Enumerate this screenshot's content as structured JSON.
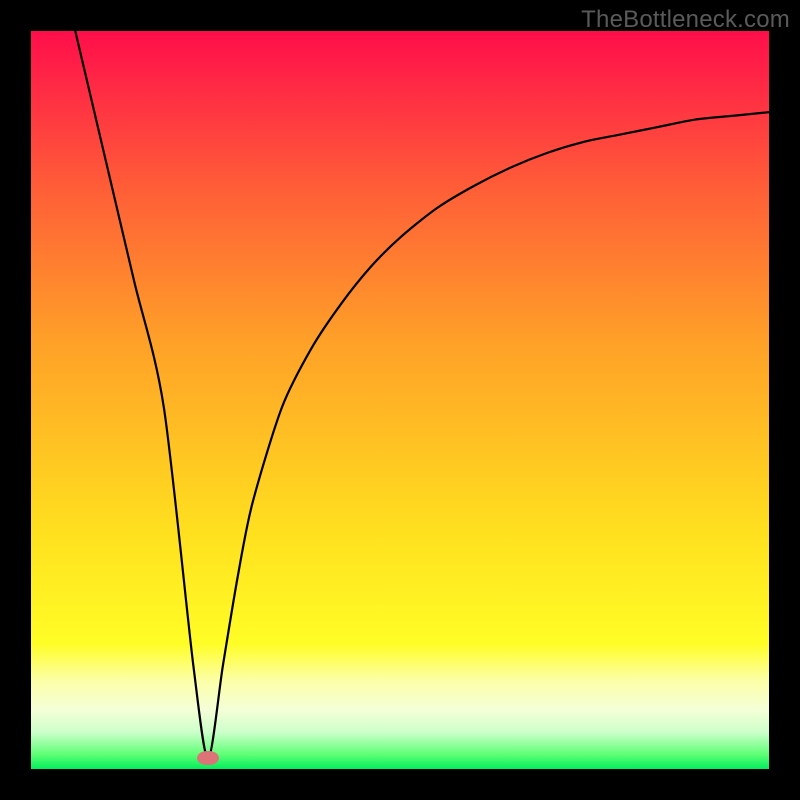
{
  "attribution": "TheBottleneck.com",
  "colors": {
    "page_bg": "#000000",
    "gradient_top": "#ff0e4a",
    "gradient_bottom": "#02ee5c",
    "curve_stroke": "#000000",
    "min_marker": "#de7377",
    "attrib_text": "#5a5a5a"
  },
  "chart_data": {
    "type": "line",
    "title": "",
    "xlabel": "",
    "ylabel": "",
    "xlim": [
      0,
      100
    ],
    "ylim": [
      0,
      100
    ],
    "grid": false,
    "legend": false,
    "note": "Axes are percentage-of-plot; y measured upward from the green baseline. V-shaped bottleneck curve with a sharp minimum near x≈24.",
    "min_point": {
      "x": 24,
      "y": 1.5
    },
    "series": [
      {
        "name": "bottleneck-curve",
        "x": [
          6,
          10,
          14,
          18,
          22,
          24,
          26,
          28,
          30,
          34,
          38,
          42,
          46,
          50,
          55,
          60,
          65,
          70,
          75,
          80,
          85,
          90,
          95,
          100
        ],
        "y": [
          100,
          83,
          66,
          49,
          14,
          1.5,
          14,
          26,
          36,
          49,
          57,
          63,
          68,
          72,
          76,
          79,
          81.5,
          83.5,
          85,
          86,
          87,
          88,
          88.5,
          89
        ]
      }
    ]
  }
}
